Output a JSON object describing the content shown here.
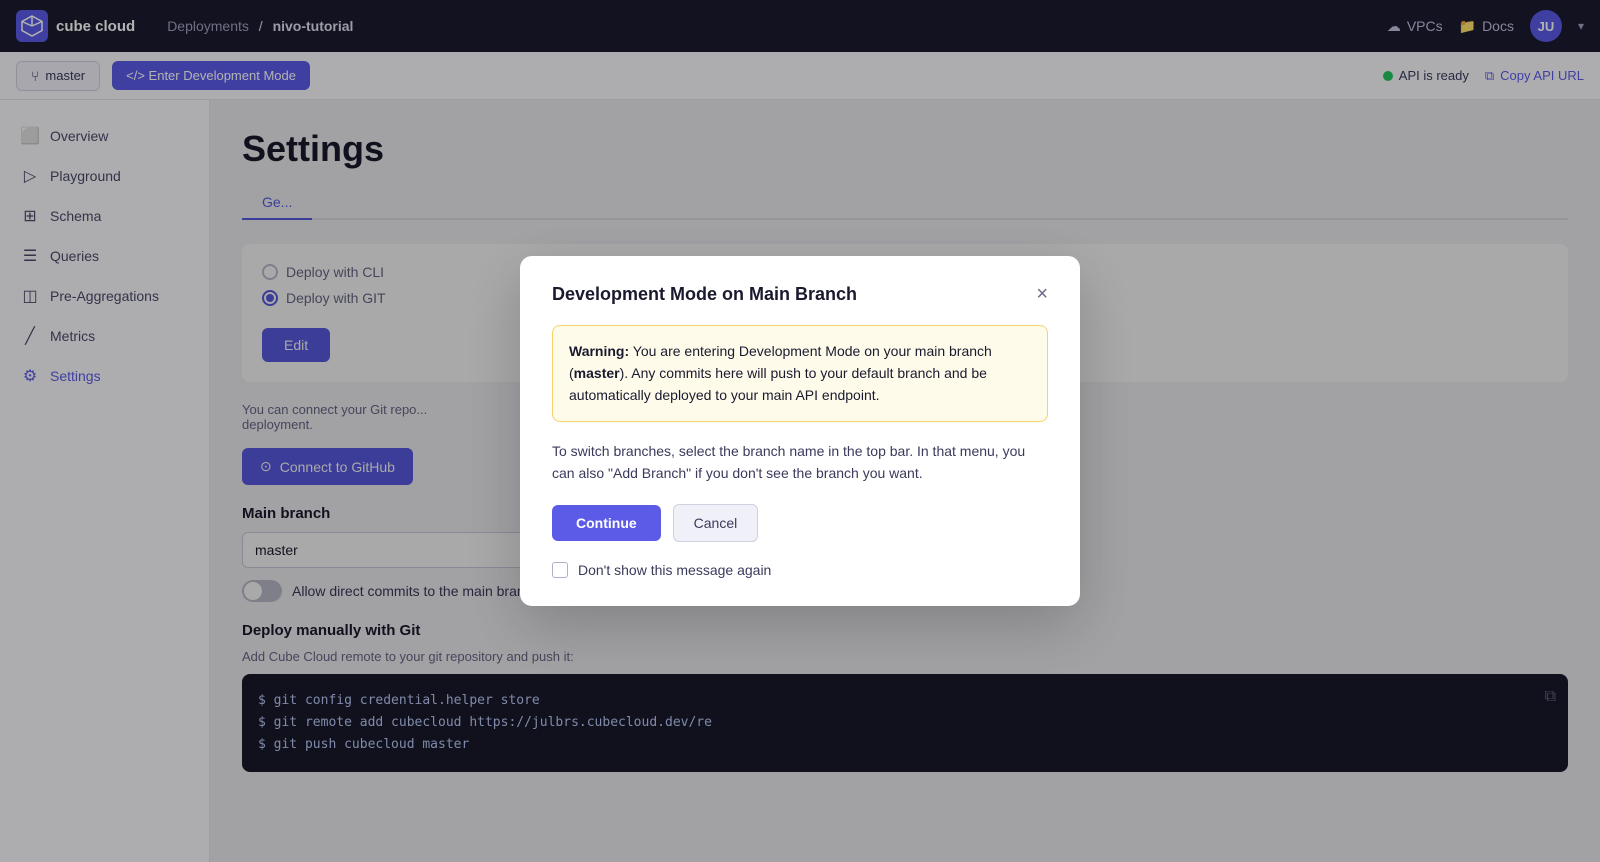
{
  "app": {
    "logo_text": "cube cloud"
  },
  "topnav": {
    "breadcrumb_parent": "Deployments",
    "breadcrumb_separator": "/",
    "breadcrumb_current": "nivo-tutorial",
    "vpcs_label": "VPCs",
    "docs_label": "Docs",
    "avatar_initials": "JU"
  },
  "subnav": {
    "branch_label": "master",
    "dev_mode_label": "</> Enter Development Mode",
    "api_status_label": "API is ready",
    "copy_api_label": "Copy API URL"
  },
  "sidebar": {
    "items": [
      {
        "id": "overview",
        "label": "Overview",
        "icon": "⬜"
      },
      {
        "id": "playground",
        "label": "Playground",
        "icon": "▶"
      },
      {
        "id": "schema",
        "label": "Schema",
        "icon": "⊞"
      },
      {
        "id": "queries",
        "label": "Queries",
        "icon": "☰"
      },
      {
        "id": "pre-aggregations",
        "label": "Pre-Aggregations",
        "icon": "📊"
      },
      {
        "id": "metrics",
        "label": "Metrics",
        "icon": "📈"
      },
      {
        "id": "settings",
        "label": "Settings",
        "icon": "⚙"
      }
    ]
  },
  "content": {
    "page_title": "Settings",
    "tab_general": "Ge...",
    "deploy_cli_label": "Deploy with CLI",
    "deploy_git_label": "Deploy with GIT",
    "edit_btn_label": "Edit",
    "git_info_line1": "You can connect your Git repo...",
    "git_info_line2": "deployment.",
    "github_btn_label": "Connect to GitHub",
    "main_branch_label": "Main branch",
    "branch_value": "master",
    "toggle_label": "Allow direct commits to the main branch",
    "deploy_manually_title": "Deploy manually with Git",
    "deploy_manually_sub": "Add Cube Cloud remote to your git repository and push it:",
    "code_line1": "$ git config credential.helper store",
    "code_line2": "$ git remote add cubecloud https://julbrs.cubecloud.dev/re",
    "code_line3": "$ git push cubecloud master"
  },
  "modal": {
    "title": "Development Mode on Main Branch",
    "warning_bold": "Warning:",
    "warning_text": " You are entering Development Mode on your main branch (master). Any commits here will push to your default branch and be automatically deployed to your main API endpoint.",
    "branch_bold": "master",
    "info_text": "To switch branches, select the branch name in the top bar. In that menu, you can also \"Add Branch\" if you don't see the branch you want.",
    "continue_label": "Continue",
    "cancel_label": "Cancel",
    "dont_show_label": "Don't show this message again"
  }
}
